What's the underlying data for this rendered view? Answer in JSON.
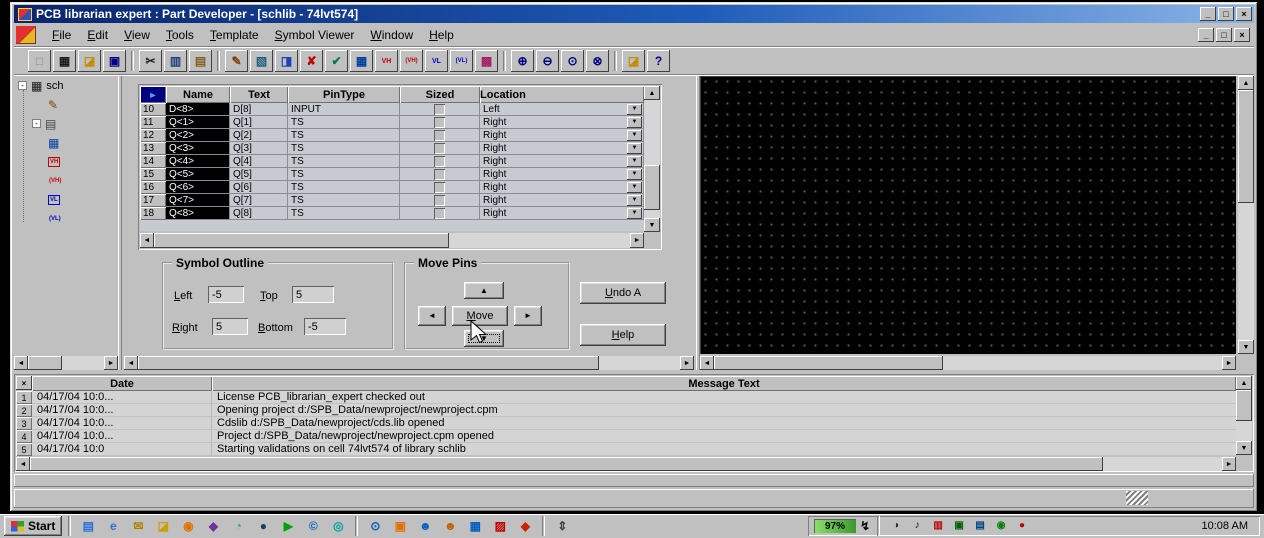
{
  "glyphs": {
    "up": "▲",
    "down": "▼",
    "left": "◄",
    "right": "►",
    "close": "×",
    "minimize": "_",
    "restore": "□"
  },
  "titlebar": {
    "title": "PCB librarian expert : Part Developer - [schlib - 74lvt574]"
  },
  "menubar": {
    "items": [
      "File",
      "Edit",
      "View",
      "Tools",
      "Template",
      "Symbol Viewer",
      "Window",
      "Help"
    ]
  },
  "toolbar": {
    "icons": [
      {
        "name": "new-part-icon",
        "glyph": "□",
        "color": "#8a8a8a"
      },
      {
        "name": "part-chip-icon",
        "glyph": "▦",
        "color": "#1a1a1a"
      },
      {
        "name": "open-icon",
        "glyph": "◪",
        "color": "#c09000"
      },
      {
        "name": "save-icon",
        "glyph": "▣",
        "color": "#000080"
      },
      {
        "sep": true
      },
      {
        "name": "cut-icon",
        "glyph": "✂",
        "color": "#202020"
      },
      {
        "name": "copy-icon",
        "glyph": "▥",
        "color": "#204080"
      },
      {
        "name": "paste-icon",
        "glyph": "▤",
        "color": "#806020"
      },
      {
        "sep": true
      },
      {
        "name": "probe-icon",
        "glyph": "✎",
        "color": "#804000"
      },
      {
        "name": "package-icon",
        "glyph": "▧",
        "color": "#206080"
      },
      {
        "name": "symbol-view-icon",
        "glyph": "◨",
        "color": "#2040c0"
      },
      {
        "name": "delete-icon",
        "glyph": "✘",
        "color": "#c00000"
      },
      {
        "name": "validate-icon",
        "glyph": "✔",
        "color": "#007858"
      },
      {
        "name": "pin-grid-icon",
        "glyph": "▦",
        "color": "#0040a0"
      },
      {
        "name": "vh-icon",
        "glyph": "VH",
        "color": "#c00000",
        "fs": 7
      },
      {
        "name": "vh-paren-icon",
        "glyph": "(VH)",
        "color": "#c00000",
        "fs": 6
      },
      {
        "name": "vl-icon",
        "glyph": "VL",
        "color": "#0000c0",
        "fs": 7
      },
      {
        "name": "vl-paren-icon",
        "glyph": "(VL)",
        "color": "#0000c0",
        "fs": 6
      },
      {
        "name": "palette-icon",
        "glyph": "▩",
        "color": "#a02060"
      },
      {
        "sep": true
      },
      {
        "name": "zoom-in-icon",
        "glyph": "⊕",
        "color": "#000080"
      },
      {
        "name": "zoom-out-icon",
        "glyph": "⊖",
        "color": "#000080"
      },
      {
        "name": "zoom-points-icon",
        "glyph": "⊙",
        "color": "#000080"
      },
      {
        "name": "zoom-fit-icon",
        "glyph": "⊗",
        "color": "#000080"
      },
      {
        "sep": true
      },
      {
        "name": "project-folder-icon",
        "glyph": "◪",
        "color": "#c09000"
      },
      {
        "name": "help-icon",
        "glyph": "?",
        "color": "#000080"
      }
    ]
  },
  "tree": {
    "collapse": "-",
    "root_label": "sch",
    "chip": "▦",
    "pen": "✎",
    "cells": "▤",
    "grid": "▦",
    "vh": "VH",
    "vhp": "(VH)",
    "vl": "VL",
    "vlp": "(VL)"
  },
  "pin_table": {
    "marker": "►",
    "columns": [
      "Name",
      "Text",
      "PinType",
      "Sized",
      "Location"
    ],
    "rows": [
      {
        "num": "10",
        "name": "D<8>",
        "text": "D[8]",
        "type": "INPUT",
        "location": "Left"
      },
      {
        "num": "11",
        "name": "Q<1>",
        "text": "Q[1]",
        "type": "TS",
        "location": "Right"
      },
      {
        "num": "12",
        "name": "Q<2>",
        "text": "Q[2]",
        "type": "TS",
        "location": "Right"
      },
      {
        "num": "13",
        "name": "Q<3>",
        "text": "Q[3]",
        "type": "TS",
        "location": "Right"
      },
      {
        "num": "14",
        "name": "Q<4>",
        "text": "Q[4]",
        "type": "TS",
        "location": "Right"
      },
      {
        "num": "15",
        "name": "Q<5>",
        "text": "Q[5]",
        "type": "TS",
        "location": "Right"
      },
      {
        "num": "16",
        "name": "Q<6>",
        "text": "Q[6]",
        "type": "TS",
        "location": "Right"
      },
      {
        "num": "17",
        "name": "Q<7>",
        "text": "Q[7]",
        "type": "TS",
        "location": "Right"
      },
      {
        "num": "18",
        "name": "Q<8>",
        "text": "Q[8]",
        "type": "TS",
        "location": "Right"
      }
    ]
  },
  "symbol_outline": {
    "title": "Symbol Outline",
    "left_label": "Left",
    "left_value": "-5",
    "top_label": "Top",
    "top_value": "5",
    "right_label": "Right",
    "right_value": "5",
    "bottom_label": "Bottom",
    "bottom_value": "-5"
  },
  "move_pins": {
    "title": "Move Pins",
    "move_label": "Move"
  },
  "side_buttons": {
    "undo_label": "Undo A",
    "help_label": "Help"
  },
  "message_log": {
    "date_header": "Date",
    "text_header": "Message Text",
    "rows": [
      {
        "num": "1",
        "date": "04/17/04  10:0...",
        "text": "License PCB_librarian_expert checked out"
      },
      {
        "num": "2",
        "date": "04/17/04  10:0...",
        "text": "Opening project d:/SPB_Data/newproject/newproject.cpm"
      },
      {
        "num": "3",
        "date": "04/17/04  10:0...",
        "text": "Cdslib d:/SPB_Data/newproject/cds.lib opened"
      },
      {
        "num": "4",
        "date": "04/17/04  10:0...",
        "text": "Project d:/SPB_Data/newproject/newproject.cpm opened"
      },
      {
        "num": "5",
        "date": "04/17/04  10:0",
        "text": "Starting validations on cell 74lvt574 of library schlib"
      }
    ]
  },
  "taskbar": {
    "start_label": "Start",
    "battery": "97%",
    "plug_glyph": "↯",
    "clock": "10:08 AM",
    "quicklaunch": [
      {
        "name": "desktop-icon",
        "glyph": "▤",
        "color": "#2a6fd6"
      },
      {
        "name": "ie-icon",
        "glyph": "e",
        "color": "#2a6fd6"
      },
      {
        "name": "mail-icon",
        "glyph": "✉",
        "color": "#b08000"
      },
      {
        "name": "folder-icon",
        "glyph": "◪",
        "color": "#c8a000"
      },
      {
        "name": "media-player-icon",
        "glyph": "◉",
        "color": "#e07000"
      },
      {
        "name": "winamp-icon",
        "glyph": "◆",
        "color": "#7030a0"
      },
      {
        "name": "quicktime-icon",
        "glyph": "◔",
        "color": "#20a0a0"
      },
      {
        "name": "globe-icon",
        "glyph": "●",
        "color": "#1a4060"
      },
      {
        "name": "player-icon",
        "glyph": "▶",
        "color": "#00a000"
      },
      {
        "name": "copyright-icon",
        "glyph": "©",
        "color": "#0060c0"
      },
      {
        "name": "swirl-icon",
        "glyph": "◎",
        "color": "#00a0a0"
      },
      {
        "sep": true
      },
      {
        "name": "search-icon",
        "glyph": "⊙",
        "color": "#0060c0"
      },
      {
        "name": "app-window-icon",
        "glyph": "▣",
        "color": "#e07000"
      },
      {
        "name": "users-icon",
        "glyph": "☻",
        "color": "#0060c0"
      },
      {
        "name": "users-alt-icon",
        "glyph": "☻",
        "color": "#c06000"
      },
      {
        "name": "spreadsheet-icon",
        "glyph": "▦",
        "color": "#0060c0"
      },
      {
        "name": "pdf-icon",
        "glyph": "▨",
        "color": "#c00000"
      },
      {
        "name": "librarian-icon",
        "glyph": "◆",
        "color": "#cc2200"
      },
      {
        "sep": true
      },
      {
        "name": "tray-arrows-icon",
        "glyph": "⇕",
        "color": "#404040"
      }
    ],
    "tray": [
      {
        "name": "display-settings-icon",
        "glyph": "◑",
        "color": "#203040"
      },
      {
        "name": "volume-icon",
        "glyph": "♪",
        "color": "#101010"
      },
      {
        "name": "display-icon",
        "glyph": "▥",
        "color": "#c00000"
      },
      {
        "name": "shield-icon",
        "glyph": "▣",
        "color": "#006000"
      },
      {
        "name": "monitor-icon",
        "glyph": "▤",
        "color": "#004080"
      },
      {
        "name": "status-icon",
        "glyph": "◉",
        "color": "#008000"
      },
      {
        "name": "alert-icon",
        "glyph": "●",
        "color": "#c00000"
      }
    ]
  }
}
